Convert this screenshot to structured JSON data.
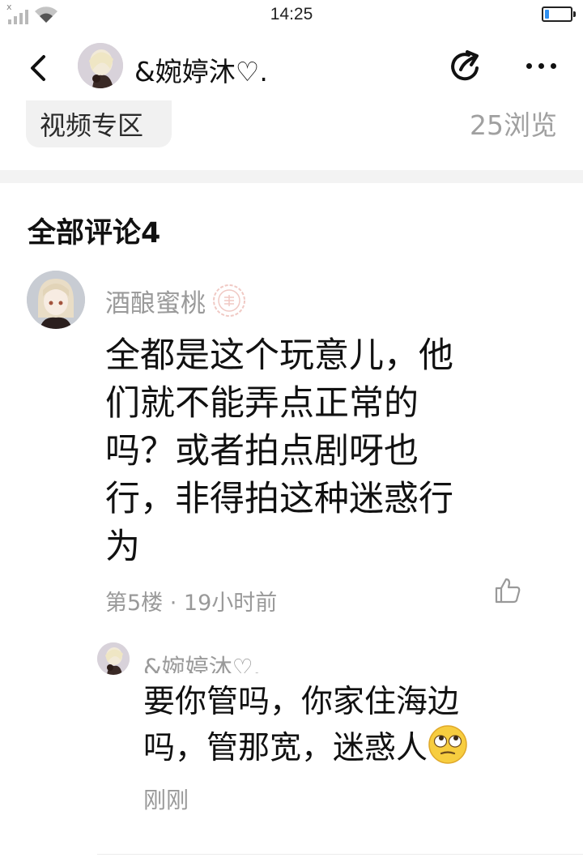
{
  "status_bar": {
    "time": "14:25",
    "battery_level": 0.15
  },
  "nav": {
    "back_icon": "chevron-left-icon",
    "title": "&婉婷沐♡.",
    "share_icon": "share-icon",
    "more_icon": "more-icon"
  },
  "post": {
    "tag": "视频专区",
    "views": "25浏览"
  },
  "comments_section": {
    "title": "全部评论4",
    "comment": {
      "username": "酒酿蜜桃",
      "badge_icon": "badge-icon",
      "body_lines": [
        "全都是这个玩意儿，他",
        "们就不能弄点正常的",
        "吗？或者拍点剧呀也",
        "行，非得拍这种迷惑行",
        "为"
      ],
      "meta": "第5楼 · 19小时前",
      "like_icon": "thumbs-up-icon"
    },
    "reply": {
      "username": "&婉婷沐♡.",
      "body_lines": [
        "要你管吗，你家住海边",
        "吗，管那宽，迷惑人"
      ],
      "emoji": "eye-roll-emoji",
      "time": "刚刚"
    }
  },
  "colors": {
    "accent": "#2f8ff0",
    "muted_text": "#999999",
    "divider": "#f3f3f3"
  }
}
